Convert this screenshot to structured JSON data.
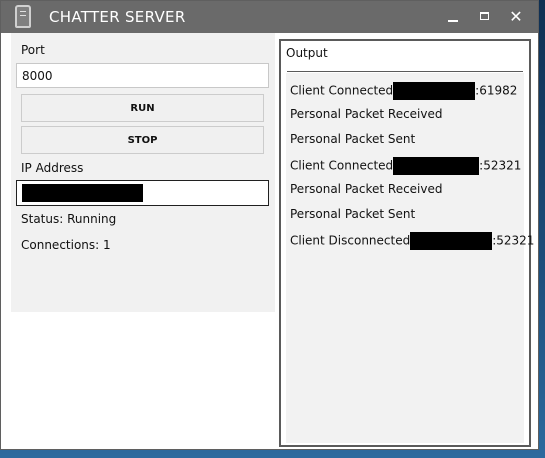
{
  "window": {
    "title": "CHATTER SERVER",
    "icon": "app-icon",
    "controls": {
      "minimize": "minimize-icon",
      "maximize": "maximize-icon",
      "close": "✕"
    }
  },
  "left": {
    "port_label": "Port",
    "port_value": "8000",
    "run_label": "RUN",
    "stop_label": "STOP",
    "ip_label": "IP Address",
    "ip_value_redacted": true,
    "status": "Status: Running",
    "connections": "Connections: 1"
  },
  "output": {
    "header": "Output",
    "items": [
      {
        "prefix": "Client Connected",
        "suffix": ":61982"
      },
      {
        "text": "Personal Packet Received"
      },
      {
        "text": "Personal Packet Sent"
      },
      {
        "prefix": "Client Connected",
        "suffix": ":52321"
      },
      {
        "text": "Personal Packet Received"
      },
      {
        "text": "Personal Packet Sent"
      },
      {
        "prefix": "Client Disconnected",
        "suffix": ":52321"
      }
    ]
  },
  "colors": {
    "titlebar": "#6a6a6a",
    "panel": "#f1f1f1",
    "output_background": "#f2f2f2",
    "desktop": "#1c4c79"
  }
}
